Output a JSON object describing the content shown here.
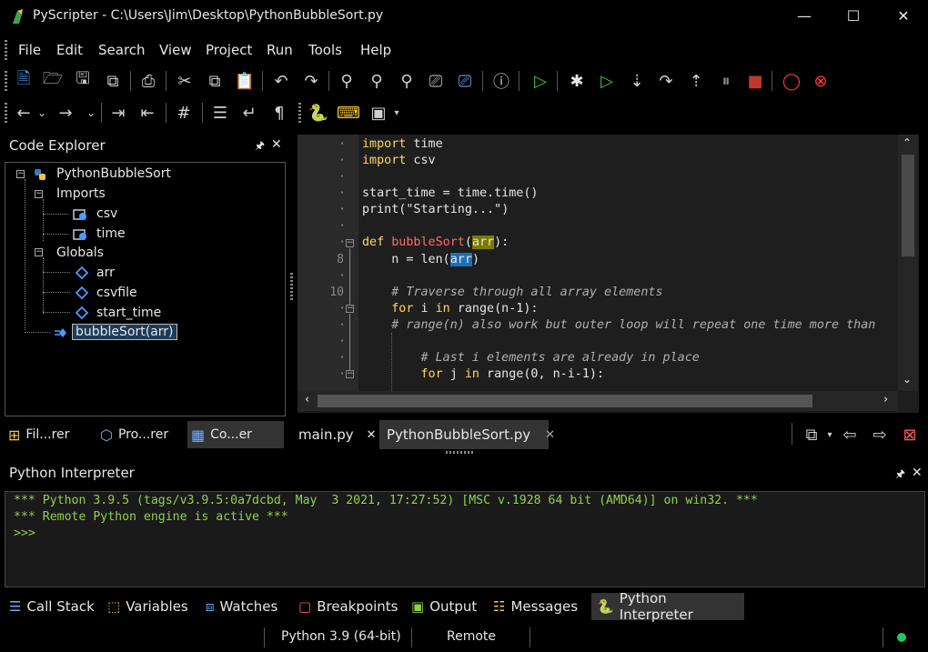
{
  "window": {
    "title": "PyScripter - C:\\Users\\Jim\\Desktop\\PythonBubbleSort.py",
    "minimize": "—",
    "maximize": "☐",
    "close": "✕"
  },
  "menu": [
    "File",
    "Edit",
    "Search",
    "View",
    "Project",
    "Run",
    "Tools",
    "Help"
  ],
  "code_explorer": {
    "title": "Code Explorer",
    "pin": "🖈",
    "close": "✕",
    "tree": {
      "root": "PythonBubbleSort",
      "imports_label": "Imports",
      "imports": [
        "csv",
        "time"
      ],
      "globals_label": "Globals",
      "globals": [
        "arr",
        "csvfile",
        "start_time"
      ],
      "function": "bubbleSort(arr)"
    },
    "tabs": [
      "Fil...rer",
      "Pro...rer",
      "Co...er"
    ]
  },
  "editor": {
    "line_numbers": [
      "8",
      "10"
    ],
    "lines": [
      "import time",
      "import csv",
      "",
      "start_time = time.time()",
      "print(\"Starting...\")",
      "",
      "def bubbleSort(arr):",
      "    n = len(arr)",
      "",
      "    # Traverse through all array elements",
      "    for i in range(n-1):",
      "    # range(n) also work but outer loop will repeat one time more than",
      "",
      "        # Last i elements are already in place",
      "        for j in range(0, n-i-1):"
    ],
    "tabs": [
      {
        "label": "main.py",
        "close": "✕"
      },
      {
        "label": "PythonBubbleSort.py",
        "close": "✕"
      }
    ]
  },
  "interpreter": {
    "title": "Python Interpreter",
    "pin": "🖈",
    "close": "✕",
    "output": [
      "*** Python 3.9.5 (tags/v3.9.5:0a7dcbd, May  3 2021, 17:27:52) [MSC v.1928 64 bit (AMD64)] on win32. ***",
      "*** Remote Python engine is active ***",
      ">>>"
    ]
  },
  "dock_tabs": [
    "Call Stack",
    "Variables",
    "Watches",
    "Breakpoints",
    "Output",
    "Messages",
    "Python Interpreter"
  ],
  "status": {
    "python_version": "Python 3.9 (64-bit)",
    "engine": "Remote",
    "indicator_color": "#22c55e"
  }
}
